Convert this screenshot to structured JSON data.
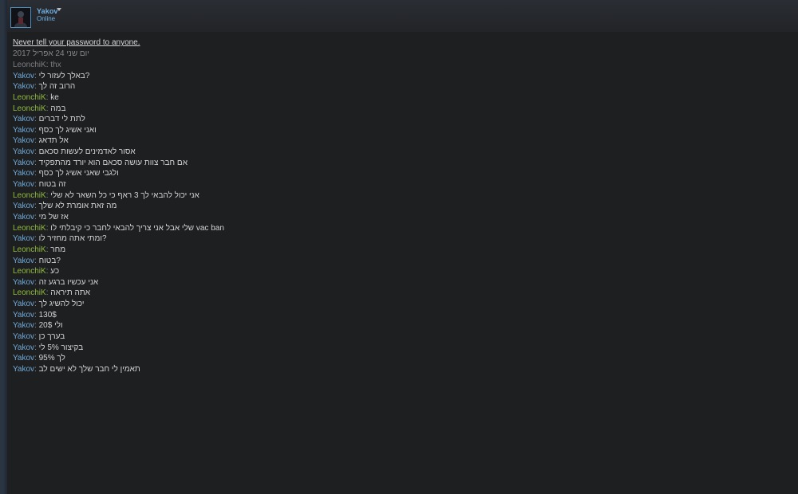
{
  "header": {
    "username": "Yakov",
    "status": "Online"
  },
  "chat": {
    "notice": "Never tell your password to anyone.",
    "date": "יום שני 24 אפריל 2017",
    "messages": [
      {
        "sender": "LeonchiK",
        "text": "thx",
        "style": "faded"
      },
      {
        "sender": "Yakov",
        "text": "באלך לעזור לי?",
        "style": "self"
      },
      {
        "sender": "Yakov",
        "text": "הרוב זה לך",
        "style": "self"
      },
      {
        "sender": "LeonchiK",
        "text": "ke",
        "style": "other"
      },
      {
        "sender": "LeonchiK",
        "text": "במה",
        "style": "other"
      },
      {
        "sender": "Yakov",
        "text": "לתת לי דברים",
        "style": "self"
      },
      {
        "sender": "Yakov",
        "text": "ואני אשיג לך כסף",
        "style": "self"
      },
      {
        "sender": "Yakov",
        "text": "אל תדאג",
        "style": "self"
      },
      {
        "sender": "Yakov",
        "text": "אסור לאדמינים לעשות סכאם",
        "style": "self"
      },
      {
        "sender": "Yakov",
        "text": "אם חבר צוות עושה סכאם הוא יורד מהתפקיד",
        "style": "self"
      },
      {
        "sender": "Yakov",
        "text": "ולגבי שאני אשיג לך כסף",
        "style": "self"
      },
      {
        "sender": "Yakov",
        "text": "זה בטוח",
        "style": "self"
      },
      {
        "sender": "LeonchiK",
        "text": "אני יכול להבאי לך 3 ראף כי כל השאר לא שלי",
        "style": "other"
      },
      {
        "sender": "Yakov",
        "text": "מה זאת אומרת לא שלך",
        "style": "self"
      },
      {
        "sender": "Yakov",
        "text": "אז של מי",
        "style": "self"
      },
      {
        "sender": "LeonchiK",
        "text": "שלי אבל אני צריך להבאי לחבר כי קיבלתי לו vac ban",
        "style": "other"
      },
      {
        "sender": "Yakov",
        "text": "ומתי אתה מחזיר לו?",
        "style": "self"
      },
      {
        "sender": "LeonchiK",
        "text": "מחר",
        "style": "other"
      },
      {
        "sender": "Yakov",
        "text": "בטוח?",
        "style": "self"
      },
      {
        "sender": "LeonchiK",
        "text": "כע",
        "style": "other"
      },
      {
        "sender": "Yakov",
        "text": "אני עכשיו ברגע זה",
        "style": "self"
      },
      {
        "sender": "LeonchiK",
        "text": "אתה תיראה",
        "style": "other"
      },
      {
        "sender": "Yakov",
        "text": "יכול להשיג לך",
        "style": "self"
      },
      {
        "sender": "Yakov",
        "text": "130$",
        "style": "self"
      },
      {
        "sender": "Yakov",
        "text": "ולי 20$",
        "style": "self"
      },
      {
        "sender": "Yakov",
        "text": "בערך כן",
        "style": "self"
      },
      {
        "sender": "Yakov",
        "text": "בקיצור 5% לי",
        "style": "self"
      },
      {
        "sender": "Yakov",
        "text": "לך 95%",
        "style": "self"
      },
      {
        "sender": "Yakov",
        "text": "תאמין לי חבר שלך לא ישים לב",
        "style": "self"
      }
    ]
  }
}
